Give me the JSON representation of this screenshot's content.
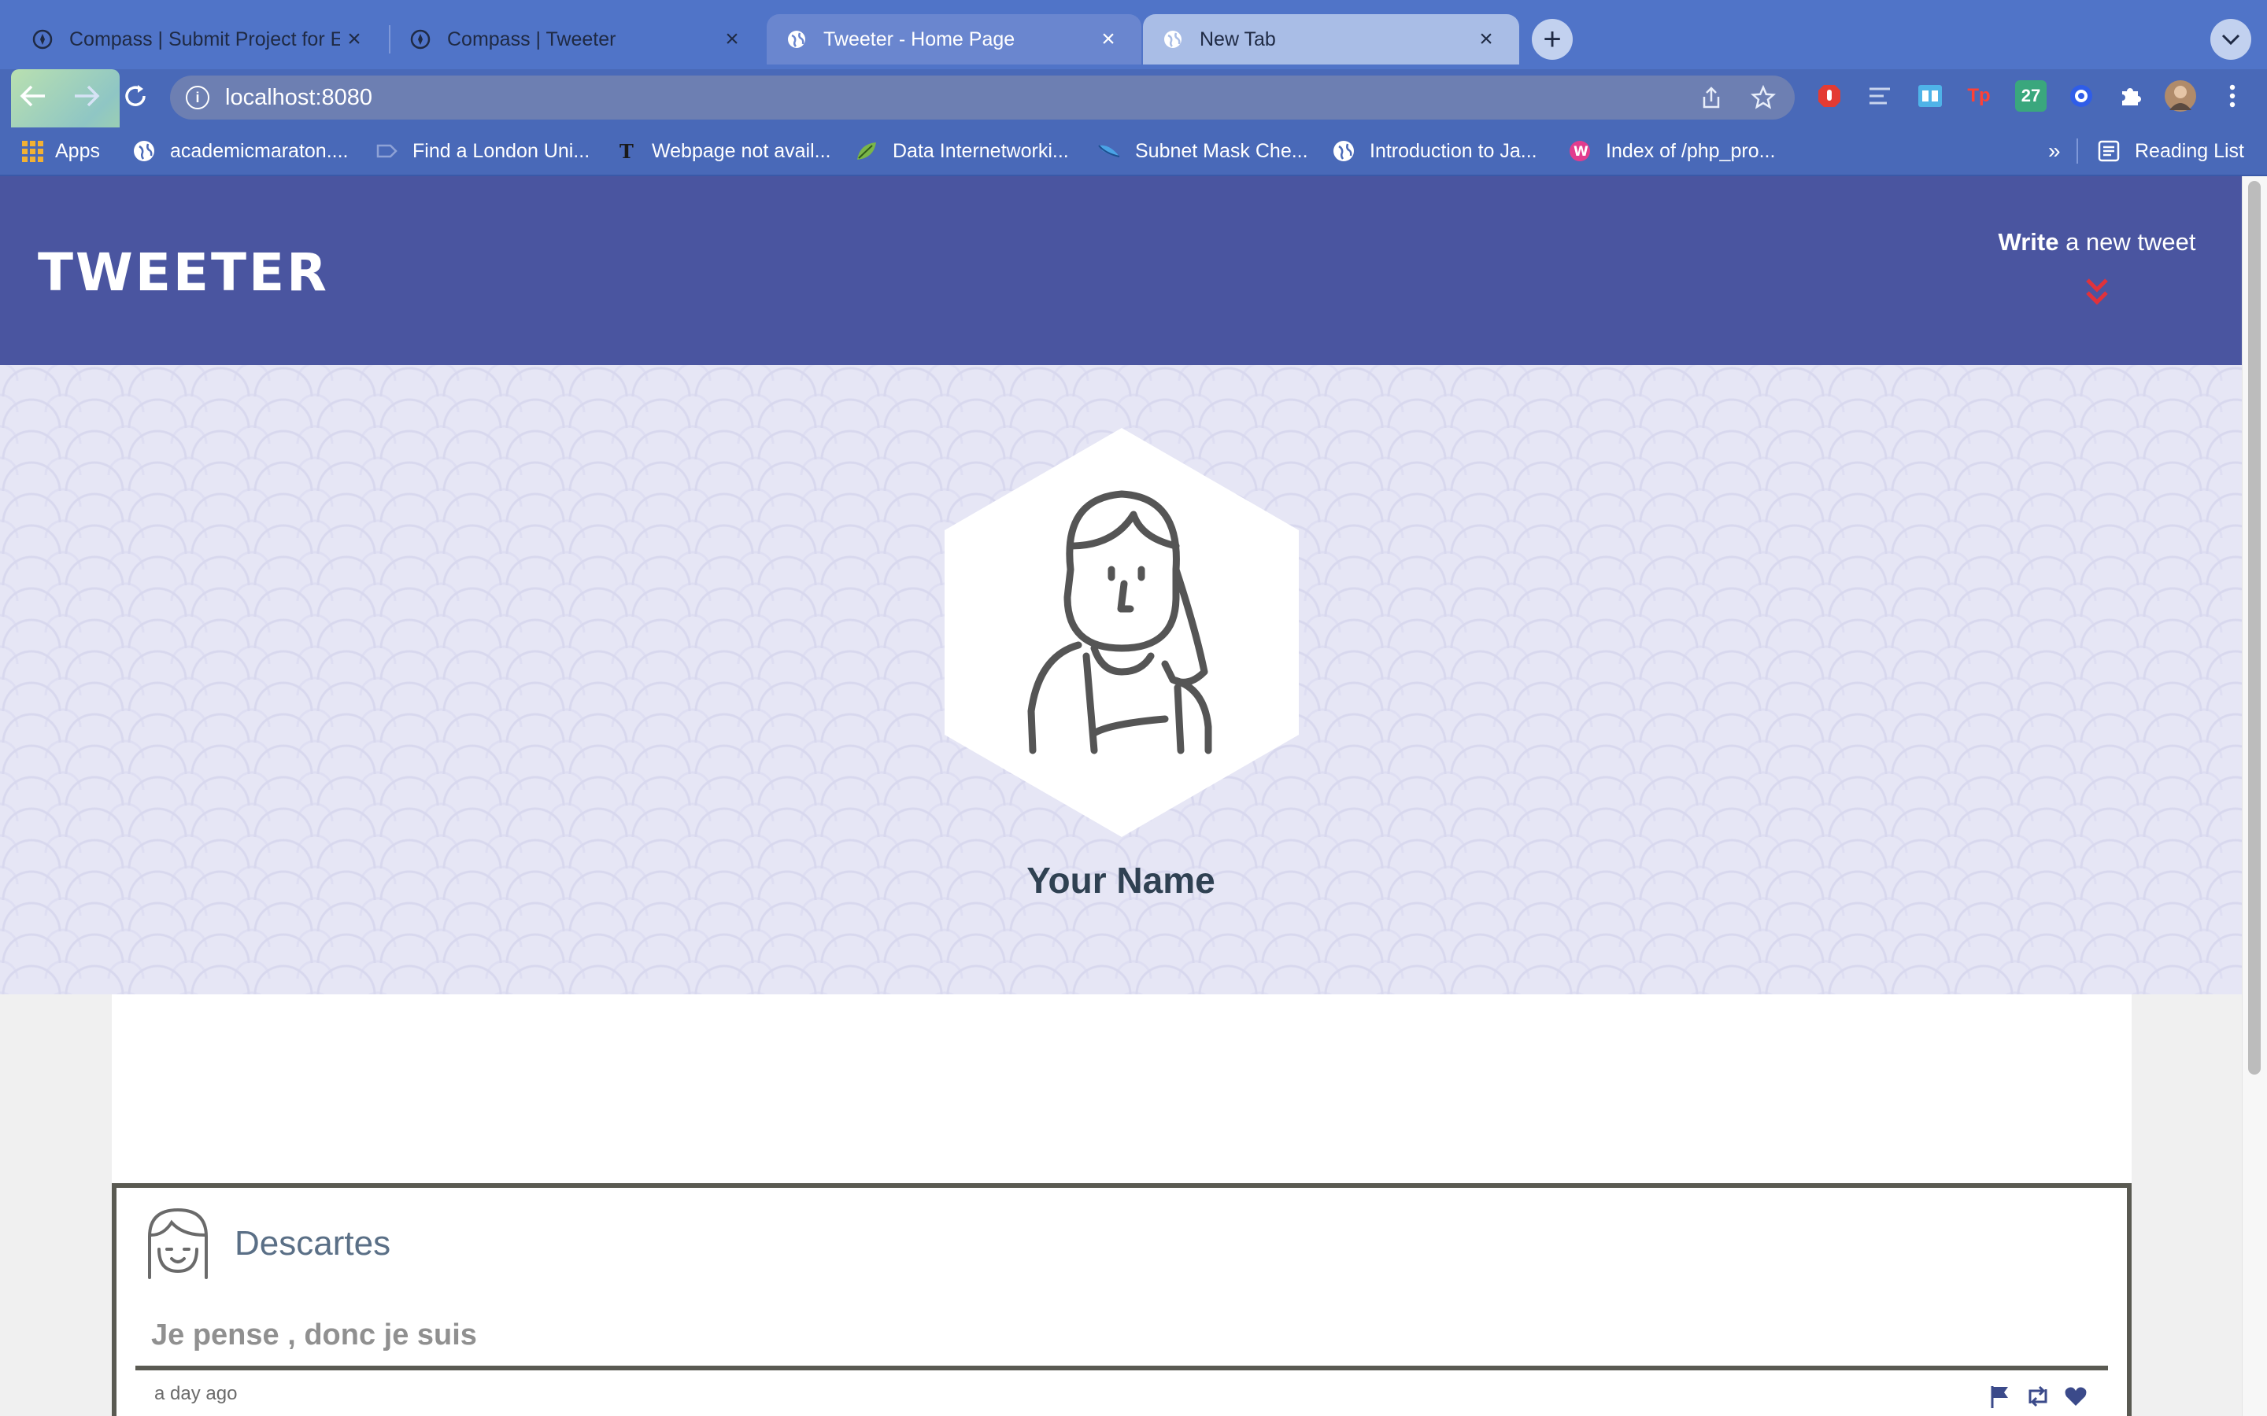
{
  "browser": {
    "tabs": [
      {
        "title": "Compass | Submit Project for E",
        "icon": "compass-icon",
        "state": "inactive"
      },
      {
        "title": "Compass | Tweeter",
        "icon": "compass-icon",
        "state": "inactive"
      },
      {
        "title": "Tweeter - Home Page",
        "icon": "globe-icon",
        "state": "active"
      },
      {
        "title": "New Tab",
        "icon": "globe-icon",
        "state": "inactive"
      }
    ],
    "url": "localhost:8080",
    "bookmarks": [
      {
        "label": "Apps",
        "icon": "apps-grid-icon"
      },
      {
        "label": "academicmaraton....",
        "icon": "globe-icon"
      },
      {
        "label": "Find a London Uni...",
        "icon": "tag-icon"
      },
      {
        "label": "Webpage not avail...",
        "icon": "nyt-icon"
      },
      {
        "label": "Data Internetworki...",
        "icon": "leaf-icon"
      },
      {
        "label": "Subnet Mask Che...",
        "icon": "bird-icon"
      },
      {
        "label": "Introduction to Ja...",
        "icon": "globe-icon"
      },
      {
        "label": "Index of /php_pro...",
        "icon": "w-logo-icon"
      }
    ],
    "overflow": "»",
    "reading_list": "Reading List",
    "extension_27": "27",
    "extension_tp": "Tp"
  },
  "site": {
    "brand": "TWEETER",
    "compose_toggle": {
      "bold": "Write",
      "rest": " a new tweet"
    },
    "profile_name": "Your Name",
    "accent": "#4a55a0"
  },
  "tweets": [
    {
      "author": "Descartes",
      "text": "Je pense , donc je suis",
      "time": "a day ago",
      "actions": [
        "flag-icon",
        "retweet-icon",
        "heart-icon"
      ]
    }
  ]
}
